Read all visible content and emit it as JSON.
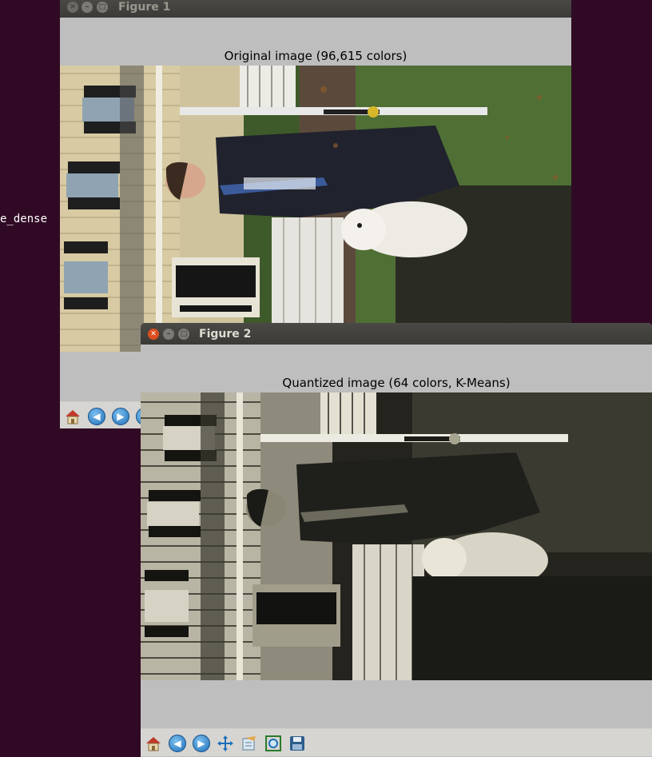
{
  "background": {
    "terminal_text": "e_dense",
    "color": "#300a24"
  },
  "figure1": {
    "window_title": "Figure 1",
    "plot_title": "Original image (96,615 colors)"
  },
  "figure2": {
    "window_title": "Figure 2",
    "plot_title": "Quantized image (64 colors, K-Means)"
  },
  "toolbar": {
    "icons": [
      "home-icon",
      "back-icon",
      "forward-icon",
      "pan-icon",
      "configure-subplots-icon",
      "zoom-icon",
      "save-icon"
    ]
  }
}
